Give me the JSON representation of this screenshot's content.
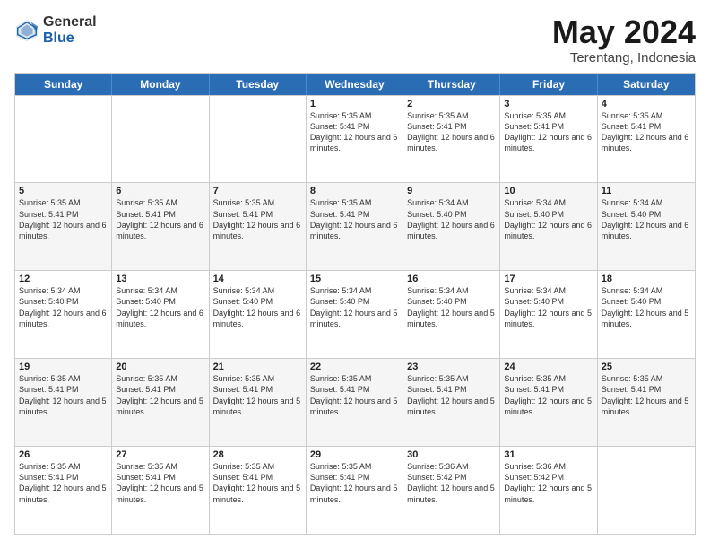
{
  "logo": {
    "general": "General",
    "blue": "Blue"
  },
  "header": {
    "month": "May 2024",
    "location": "Terentang, Indonesia"
  },
  "weekdays": [
    "Sunday",
    "Monday",
    "Tuesday",
    "Wednesday",
    "Thursday",
    "Friday",
    "Saturday"
  ],
  "rows": [
    [
      {
        "day": "",
        "text": ""
      },
      {
        "day": "",
        "text": ""
      },
      {
        "day": "",
        "text": ""
      },
      {
        "day": "1",
        "text": "Sunrise: 5:35 AM\nSunset: 5:41 PM\nDaylight: 12 hours\nand 6 minutes."
      },
      {
        "day": "2",
        "text": "Sunrise: 5:35 AM\nSunset: 5:41 PM\nDaylight: 12 hours\nand 6 minutes."
      },
      {
        "day": "3",
        "text": "Sunrise: 5:35 AM\nSunset: 5:41 PM\nDaylight: 12 hours\nand 6 minutes."
      },
      {
        "day": "4",
        "text": "Sunrise: 5:35 AM\nSunset: 5:41 PM\nDaylight: 12 hours\nand 6 minutes."
      }
    ],
    [
      {
        "day": "5",
        "text": "Sunrise: 5:35 AM\nSunset: 5:41 PM\nDaylight: 12 hours\nand 6 minutes."
      },
      {
        "day": "6",
        "text": "Sunrise: 5:35 AM\nSunset: 5:41 PM\nDaylight: 12 hours\nand 6 minutes."
      },
      {
        "day": "7",
        "text": "Sunrise: 5:35 AM\nSunset: 5:41 PM\nDaylight: 12 hours\nand 6 minutes."
      },
      {
        "day": "8",
        "text": "Sunrise: 5:35 AM\nSunset: 5:41 PM\nDaylight: 12 hours\nand 6 minutes."
      },
      {
        "day": "9",
        "text": "Sunrise: 5:34 AM\nSunset: 5:40 PM\nDaylight: 12 hours\nand 6 minutes."
      },
      {
        "day": "10",
        "text": "Sunrise: 5:34 AM\nSunset: 5:40 PM\nDaylight: 12 hours\nand 6 minutes."
      },
      {
        "day": "11",
        "text": "Sunrise: 5:34 AM\nSunset: 5:40 PM\nDaylight: 12 hours\nand 6 minutes."
      }
    ],
    [
      {
        "day": "12",
        "text": "Sunrise: 5:34 AM\nSunset: 5:40 PM\nDaylight: 12 hours\nand 6 minutes."
      },
      {
        "day": "13",
        "text": "Sunrise: 5:34 AM\nSunset: 5:40 PM\nDaylight: 12 hours\nand 6 minutes."
      },
      {
        "day": "14",
        "text": "Sunrise: 5:34 AM\nSunset: 5:40 PM\nDaylight: 12 hours\nand 6 minutes."
      },
      {
        "day": "15",
        "text": "Sunrise: 5:34 AM\nSunset: 5:40 PM\nDaylight: 12 hours\nand 5 minutes."
      },
      {
        "day": "16",
        "text": "Sunrise: 5:34 AM\nSunset: 5:40 PM\nDaylight: 12 hours\nand 5 minutes."
      },
      {
        "day": "17",
        "text": "Sunrise: 5:34 AM\nSunset: 5:40 PM\nDaylight: 12 hours\nand 5 minutes."
      },
      {
        "day": "18",
        "text": "Sunrise: 5:34 AM\nSunset: 5:40 PM\nDaylight: 12 hours\nand 5 minutes."
      }
    ],
    [
      {
        "day": "19",
        "text": "Sunrise: 5:35 AM\nSunset: 5:41 PM\nDaylight: 12 hours\nand 5 minutes."
      },
      {
        "day": "20",
        "text": "Sunrise: 5:35 AM\nSunset: 5:41 PM\nDaylight: 12 hours\nand 5 minutes."
      },
      {
        "day": "21",
        "text": "Sunrise: 5:35 AM\nSunset: 5:41 PM\nDaylight: 12 hours\nand 5 minutes."
      },
      {
        "day": "22",
        "text": "Sunrise: 5:35 AM\nSunset: 5:41 PM\nDaylight: 12 hours\nand 5 minutes."
      },
      {
        "day": "23",
        "text": "Sunrise: 5:35 AM\nSunset: 5:41 PM\nDaylight: 12 hours\nand 5 minutes."
      },
      {
        "day": "24",
        "text": "Sunrise: 5:35 AM\nSunset: 5:41 PM\nDaylight: 12 hours\nand 5 minutes."
      },
      {
        "day": "25",
        "text": "Sunrise: 5:35 AM\nSunset: 5:41 PM\nDaylight: 12 hours\nand 5 minutes."
      }
    ],
    [
      {
        "day": "26",
        "text": "Sunrise: 5:35 AM\nSunset: 5:41 PM\nDaylight: 12 hours\nand 5 minutes."
      },
      {
        "day": "27",
        "text": "Sunrise: 5:35 AM\nSunset: 5:41 PM\nDaylight: 12 hours\nand 5 minutes."
      },
      {
        "day": "28",
        "text": "Sunrise: 5:35 AM\nSunset: 5:41 PM\nDaylight: 12 hours\nand 5 minutes."
      },
      {
        "day": "29",
        "text": "Sunrise: 5:35 AM\nSunset: 5:41 PM\nDaylight: 12 hours\nand 5 minutes."
      },
      {
        "day": "30",
        "text": "Sunrise: 5:36 AM\nSunset: 5:42 PM\nDaylight: 12 hours\nand 5 minutes."
      },
      {
        "day": "31",
        "text": "Sunrise: 5:36 AM\nSunset: 5:42 PM\nDaylight: 12 hours\nand 5 minutes."
      },
      {
        "day": "",
        "text": ""
      }
    ]
  ]
}
